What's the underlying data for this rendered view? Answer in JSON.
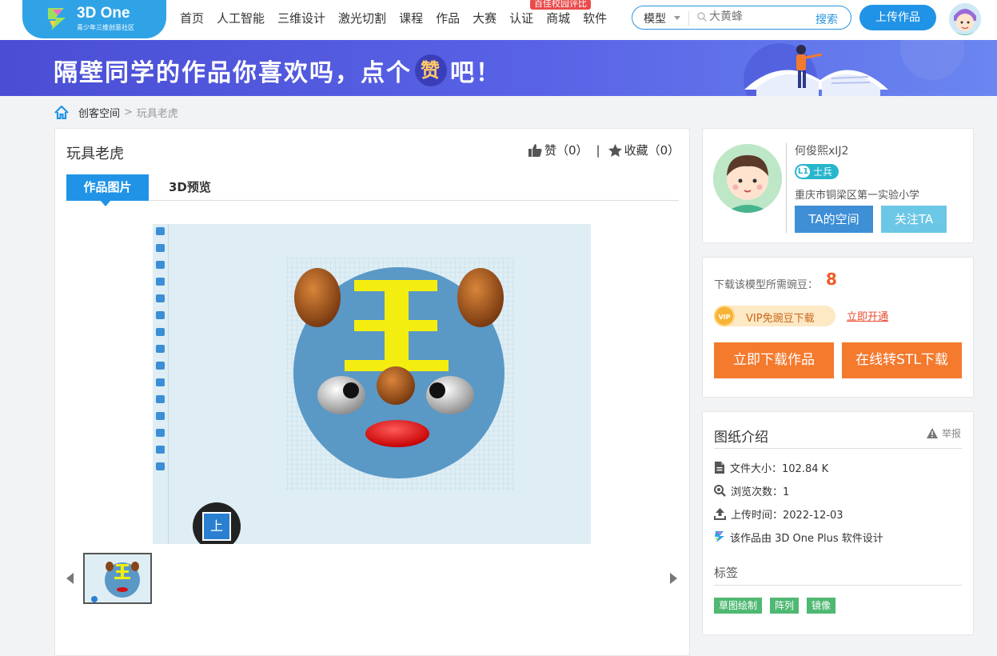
{
  "header": {
    "logo_title": "3D One",
    "logo_sub": "青少年三维创意社区",
    "nav": [
      "首页",
      "人工智能",
      "三维设计",
      "激光切割",
      "课程",
      "作品",
      "大赛",
      "认证",
      "商城",
      "软件"
    ],
    "eval_badge": "百佳校园评比",
    "search": {
      "type": "模型",
      "placeholder": "大黄蜂",
      "button": "搜索"
    },
    "upload": "上传作品"
  },
  "banner": {
    "text_a": "隔壁同学的作品你喜欢吗，点个",
    "highlight": "赞",
    "text_b": "吧！"
  },
  "breadcrumb": {
    "link": "创客空间",
    "sep": ">",
    "current": "玩具老虎"
  },
  "work": {
    "title": "玩具老虎",
    "like_label": "赞（0）",
    "divider": "|",
    "fav_label": "收藏（0）",
    "tabs": [
      "作品图片",
      "3D预览"
    ],
    "up_button": "上"
  },
  "author": {
    "name": "何俊熙xIJ2",
    "level": "L1",
    "rank": "士兵",
    "school": "重庆市铜梁区第一实验小学",
    "space_btn": "TA的空间",
    "follow_btn": "关注TA"
  },
  "download": {
    "need_label": "下载该模型所需豌豆：",
    "count": "8",
    "vip_icon": "VIP",
    "vip_text": "VIP免豌豆下载",
    "vip_open": "立即开通",
    "dl_btn": "立即下载作品",
    "stl_btn": "在线转STL下载"
  },
  "intro": {
    "title": "图纸介绍",
    "report": "举报",
    "file_size": "文件大小：102.84 K",
    "views": "浏览次数：1",
    "upload_time": "上传时间：2022-12-03",
    "software": "该作品由 3D One Plus 软件设计",
    "tags_title": "标签",
    "tags": [
      "草图绘制",
      "阵列",
      "镜像"
    ]
  },
  "colors": {
    "primary": "#2193e6",
    "orange": "#f47a2e",
    "banner": "#5963e6",
    "tag": "#4fb872"
  }
}
